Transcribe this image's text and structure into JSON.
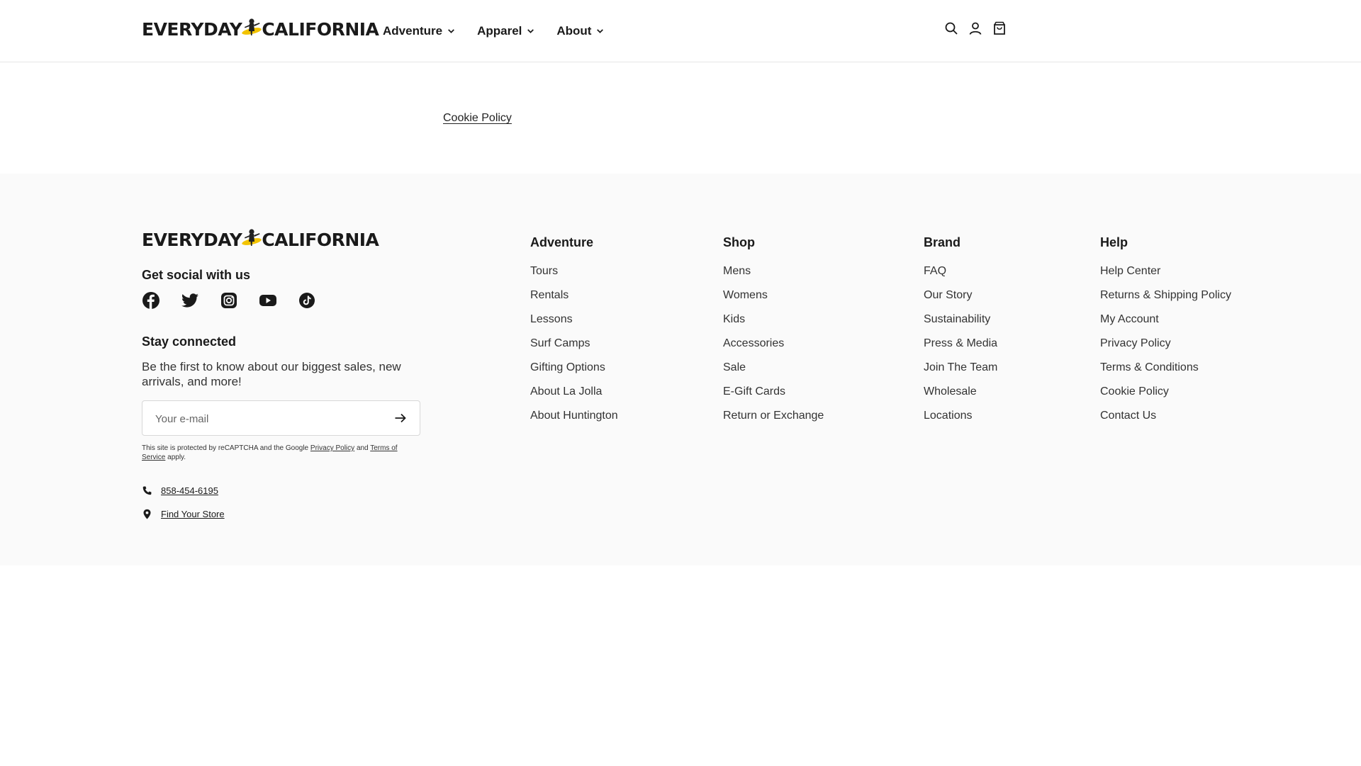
{
  "brand": {
    "left": "EVERYDAY",
    "right": "CALIFORNIA"
  },
  "nav": [
    {
      "label": "Adventure"
    },
    {
      "label": "Apparel"
    },
    {
      "label": "About"
    }
  ],
  "header_icons": [
    "search-icon",
    "account-icon",
    "cart-icon"
  ],
  "main": {
    "link": "Cookie Policy"
  },
  "footer": {
    "social_title": "Get social with us",
    "social": [
      "facebook-icon",
      "twitter-icon",
      "instagram-icon",
      "youtube-icon",
      "tiktok-icon"
    ],
    "stay_title": "Stay connected",
    "stay_desc": "Be the first to know about our biggest sales, new arrivals, and more!",
    "email_placeholder": "Your e-mail",
    "recaptcha": {
      "prefix": "This site is protected by reCAPTCHA and the Google",
      "privacy": "Privacy Policy",
      "and": "and",
      "terms": "Terms of Service",
      "suffix": "apply."
    },
    "phone": "858-454-6195",
    "store": "Find Your Store",
    "columns": [
      {
        "title": "Adventure",
        "links": [
          "Tours",
          "Rentals",
          "Lessons",
          "Surf Camps",
          "Gifting Options",
          "About La Jolla",
          "About Huntington"
        ]
      },
      {
        "title": "Shop",
        "links": [
          "Mens",
          "Womens",
          "Kids",
          "Accessories",
          "Sale",
          "E-Gift Cards",
          "Return or Exchange"
        ]
      },
      {
        "title": "Brand",
        "links": [
          "FAQ",
          "Our Story",
          "Sustainability",
          "Press & Media",
          "Join The Team",
          "Wholesale",
          "Locations"
        ]
      },
      {
        "title": "Help",
        "links": [
          "Help Center",
          "Returns & Shipping Policy",
          "My Account",
          "Privacy Policy",
          "Terms & Conditions",
          "Cookie Policy",
          "Contact Us"
        ]
      }
    ]
  }
}
